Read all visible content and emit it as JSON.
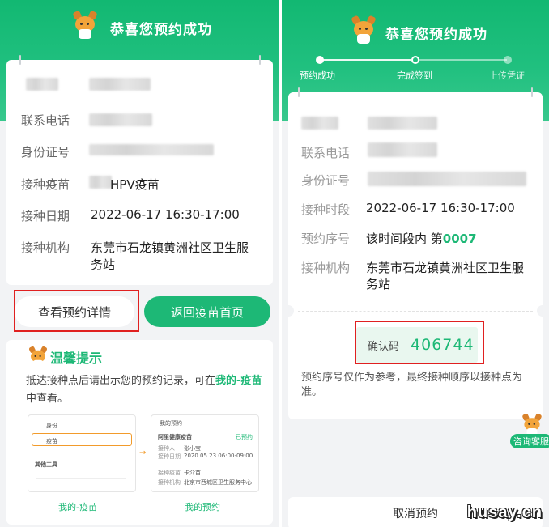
{
  "left": {
    "header_title": "恭喜您预约成功",
    "labels": {
      "phone": "联系电话",
      "id_card": "身份证号",
      "vaccine": "接种疫苗",
      "date": "接种日期",
      "org": "接种机构"
    },
    "values": {
      "vaccine": "HPV疫苗",
      "date": "2022-06-17 16:30-17:00",
      "org_line1": "东莞市石龙镇黄洲社区卫生服",
      "org_line2": "务站"
    },
    "buttons": {
      "details": "查看预约详情",
      "home": "返回疫苗首页"
    },
    "tip": {
      "title": "温馨提示",
      "text_a": "抵达接种点后请出示您的预约记录，可在",
      "text_link": "我的-疫苗",
      "text_b": "中查看。",
      "caption1": "我的-疫苗",
      "caption2": "我的预约",
      "mini1": {
        "r1": "身份",
        "r2": "疫苗",
        "r3": "其他工具"
      },
      "mini2": {
        "title": "我的预约",
        "vac": "阿里健康疫苗",
        "status": "已预约",
        "p1l": "接种人",
        "p1v": "张小宝",
        "p2l": "接种日期",
        "p2v": "2020.05.23 06:00-09:00",
        "p3l": "接种疫苗",
        "p3v": "卡介苗",
        "p4l": "接种机构",
        "p4v": "北京市西城区卫生服务中心"
      }
    }
  },
  "right": {
    "header_title": "恭喜您预约成功",
    "steps": [
      "预约成功",
      "完成签到",
      "上传凭证"
    ],
    "labels": {
      "phone": "联系电话",
      "id_card": "身份证号",
      "time": "接种时段",
      "seq": "预约序号",
      "org": "接种机构"
    },
    "values": {
      "time": "2022-06-17 16:30-17:00",
      "seq_prefix": "该时间段内 第",
      "seq_num": "0007",
      "org_line1": "东莞市石龙镇黄洲社区卫生服",
      "org_line2": "务站"
    },
    "code_label": "确认码",
    "code_value": "406744",
    "note": "预约序号仅作为参考，最终接种顺序以接种点为准。",
    "cancel": "取消预约",
    "service": "咨询客服"
  },
  "watermark": "husay.cn",
  "colors": {
    "brand_green": "#1db876",
    "highlight_red": "#e02020"
  }
}
